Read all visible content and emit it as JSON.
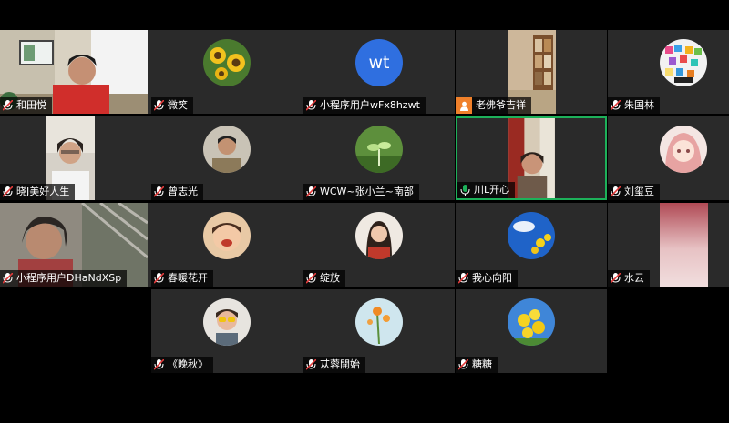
{
  "meeting": {
    "colors": {
      "background": "#000000",
      "tile": "#2a2a2a",
      "active_speaker": "#1db15a",
      "initials_avatar": "#2f6fe0",
      "host_badge": "#f0802a"
    },
    "participants": [
      {
        "name": "和田悦",
        "view": "video",
        "mic": "muted"
      },
      {
        "name": "微笑",
        "view": "avatar",
        "avatar": "sunflowers",
        "mic": "muted"
      },
      {
        "name": "小程序用户wFx8hzwt",
        "view": "initials",
        "initials": "wt",
        "mic": "muted"
      },
      {
        "name": "老佛爷吉祥",
        "view": "video",
        "mic": "none",
        "badge": "person-icon"
      },
      {
        "name": "朱国林",
        "view": "avatar",
        "avatar": "pixel-art",
        "mic": "muted"
      },
      {
        "name": "晓J美好人生",
        "view": "video",
        "mic": "muted"
      },
      {
        "name": "曾志光",
        "view": "avatar",
        "avatar": "portrait",
        "mic": "muted"
      },
      {
        "name": "WCW~张小兰~南部",
        "view": "avatar",
        "avatar": "sprout",
        "mic": "muted"
      },
      {
        "name": "川L开心",
        "view": "video",
        "mic": "active",
        "speaking": true
      },
      {
        "name": "刘玺豆",
        "view": "avatar",
        "avatar": "anime-girl",
        "mic": "muted"
      },
      {
        "name": "小程序用户DHaNdXSp",
        "view": "video",
        "mic": "muted"
      },
      {
        "name": "春暖花开",
        "view": "avatar",
        "avatar": "child",
        "mic": "muted"
      },
      {
        "name": "绽放",
        "view": "avatar",
        "avatar": "woman",
        "mic": "muted"
      },
      {
        "name": "我心向阳",
        "view": "avatar",
        "avatar": "blue-sky-flowers",
        "mic": "muted"
      },
      {
        "name": "水云",
        "view": "video",
        "mic": "muted"
      },
      {
        "name": "《晚秋》",
        "view": "avatar",
        "avatar": "woman-sunglasses",
        "mic": "muted"
      },
      {
        "name": "苁蓉開始",
        "view": "avatar",
        "avatar": "orange-flowers",
        "mic": "muted"
      },
      {
        "name": "糖糖",
        "view": "avatar",
        "avatar": "yellow-flowers",
        "mic": "muted"
      }
    ]
  }
}
